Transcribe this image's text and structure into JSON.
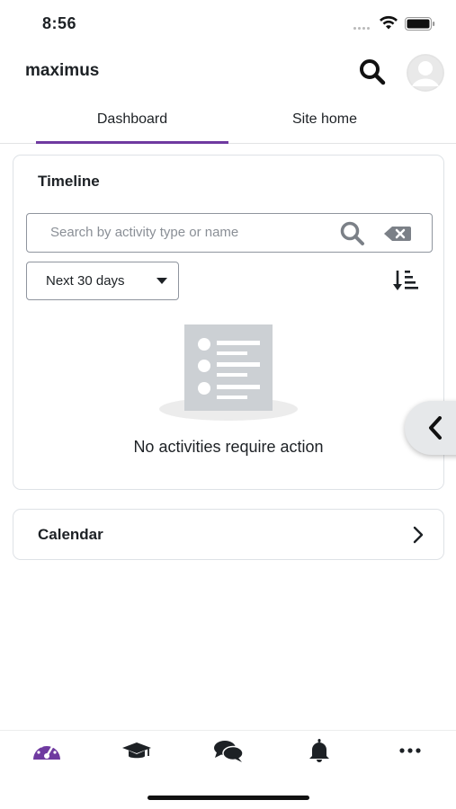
{
  "status_bar": {
    "time": "8:56"
  },
  "header": {
    "site_name": "maximus"
  },
  "tabs": [
    {
      "label": "Dashboard",
      "active": true
    },
    {
      "label": "Site home",
      "active": false
    }
  ],
  "timeline": {
    "title": "Timeline",
    "search_placeholder": "Search by activity type or name",
    "filter_value": "Next 30 days",
    "empty_message": "No activities require action"
  },
  "calendar": {
    "title": "Calendar"
  },
  "bottom_nav": [
    {
      "icon": "dashboard-gauge-icon",
      "active": true
    },
    {
      "icon": "graduation-cap-icon",
      "active": false
    },
    {
      "icon": "chat-bubbles-icon",
      "active": false
    },
    {
      "icon": "bell-icon",
      "active": false
    },
    {
      "icon": "more-icon",
      "active": false
    }
  ],
  "colors": {
    "accent": "#6f3aa0",
    "text": "#1d2125",
    "muted": "#8a8f96"
  }
}
